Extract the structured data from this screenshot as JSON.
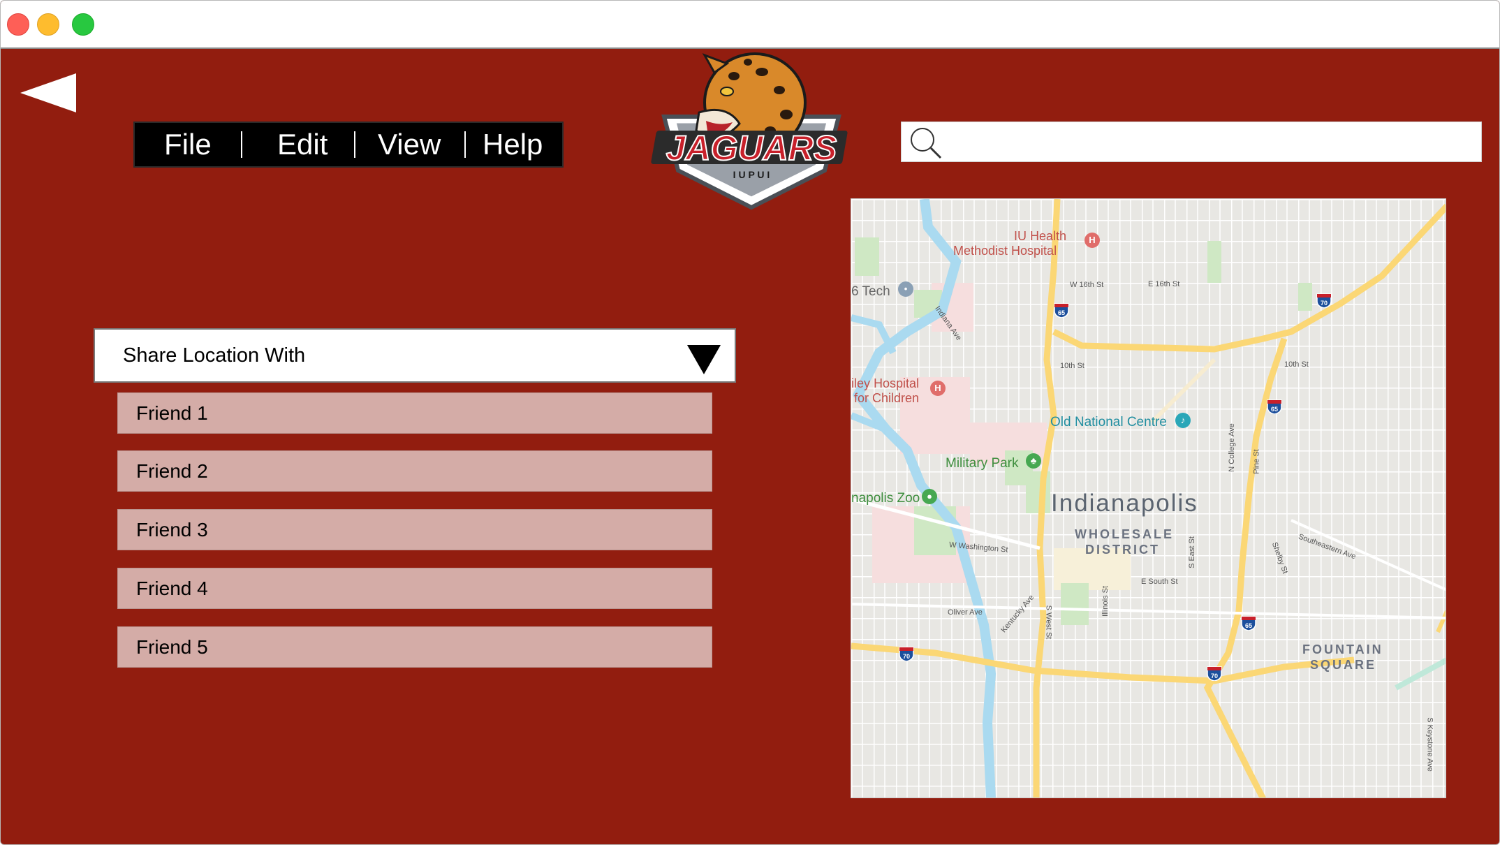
{
  "menu": {
    "file": "File",
    "edit": "Edit",
    "view": "View",
    "help": "Help"
  },
  "logo": {
    "text": "JAGUARS",
    "subtext": "I U P U I"
  },
  "search": {
    "value": ""
  },
  "share": {
    "label": "Share Location With",
    "friends": [
      "Friend 1",
      "Friend 2",
      "Friend 3",
      "Friend 4",
      "Friend 5"
    ]
  },
  "map": {
    "labels": {
      "iu_health": "IU Health",
      "methodist": "Methodist Hospital",
      "tech": "6 Tech",
      "riley1": "iley Hospital",
      "riley2": "for Children",
      "old_national": "Old National Centre",
      "military_park": "Military Park",
      "zoo": "napolis Zoo",
      "city": "Indianapolis",
      "district1": "WHOLESALE",
      "district2": "DISTRICT",
      "fountain1": "FOUNTAIN",
      "fountain2": "SQUARE",
      "w16": "W 16th St",
      "e16": "E 16th St",
      "tenth": "10th St",
      "tenth_e": "10th St",
      "indiana_ave": "Indiana Ave",
      "college": "N College Ave",
      "pine": "Pine St",
      "washington": "W Washington St",
      "south": "E South St",
      "east": "S East St",
      "oliver": "Oliver Ave",
      "kentucky": "Kentucky Ave",
      "west": "S West St",
      "illinois": "Illinois St",
      "southeastern": "Southeastern Ave",
      "shelby": "Shelby St",
      "keystone": "S Keystone Ave"
    },
    "shields": [
      "65",
      "70",
      "65",
      "65",
      "70",
      "70"
    ]
  },
  "colors": {
    "background": "#921d0f",
    "friend_row": "#d4aca7",
    "menu_bg": "#000000"
  }
}
